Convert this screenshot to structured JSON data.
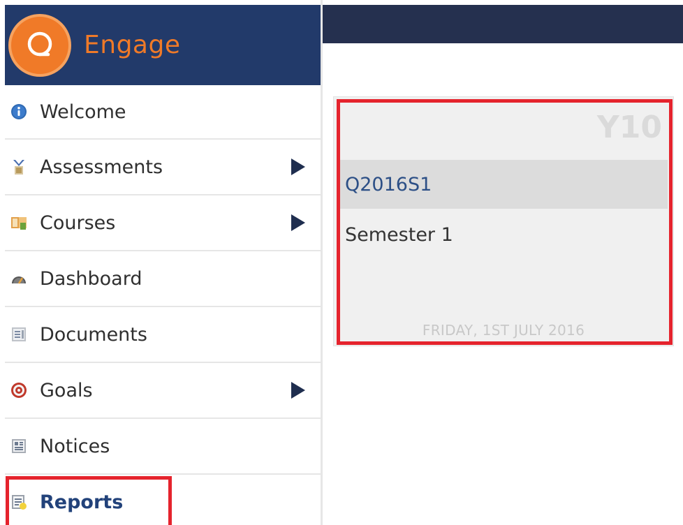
{
  "app": {
    "brand_name": "Engage",
    "brand_color": "#f07a28",
    "header_color": "#223a6a"
  },
  "sidebar": {
    "items": [
      {
        "label": "Welcome",
        "icon": "info-icon",
        "has_submenu": false
      },
      {
        "label": "Assessments",
        "icon": "assessments-icon",
        "has_submenu": true
      },
      {
        "label": "Courses",
        "icon": "courses-icon",
        "has_submenu": true
      },
      {
        "label": "Dashboard",
        "icon": "dashboard-gauge-icon",
        "has_submenu": false
      },
      {
        "label": "Documents",
        "icon": "documents-icon",
        "has_submenu": false
      },
      {
        "label": "Goals",
        "icon": "goals-target-icon",
        "has_submenu": true
      },
      {
        "label": "Notices",
        "icon": "notices-icon",
        "has_submenu": false
      },
      {
        "label": "Reports",
        "icon": "reports-icon",
        "has_submenu": false,
        "active": true
      }
    ]
  },
  "report_card": {
    "grade": "Y10",
    "code": "Q2016S1",
    "term": "Semester 1",
    "date": "FRIDAY, 1ST JULY 2016"
  },
  "colors": {
    "highlight": "#e5232d",
    "link": "#2c4f86"
  }
}
